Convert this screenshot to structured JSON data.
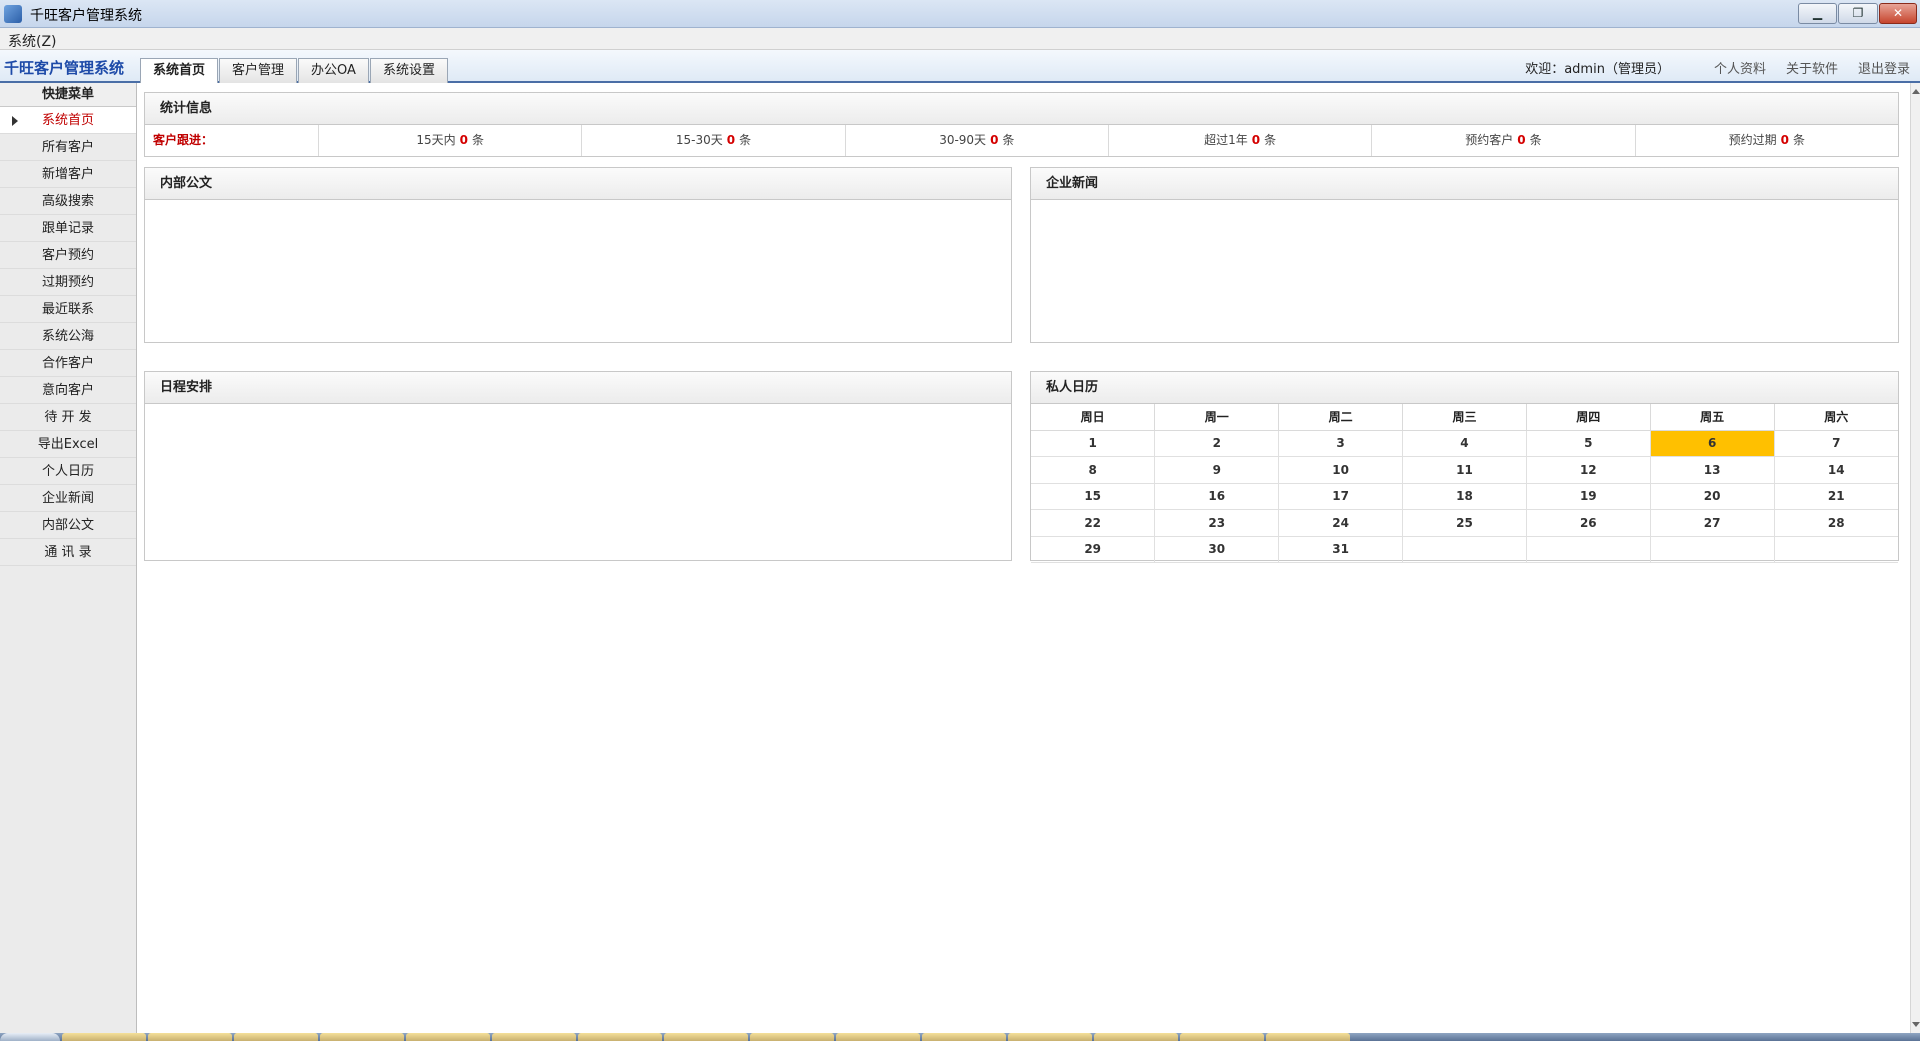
{
  "window": {
    "title": "千旺客户管理系统"
  },
  "menubar": {
    "items": [
      "系统(Z)"
    ]
  },
  "header": {
    "brand": "千旺客户管理系统",
    "tabs": [
      "系统首页",
      "客户管理",
      "办公OA",
      "系统设置"
    ],
    "active_tab": 0,
    "welcome": "欢迎：admin（管理员）",
    "links": [
      "个人资料",
      "关于软件",
      "退出登录"
    ]
  },
  "sidebar": {
    "title": "快捷菜单",
    "items": [
      "系统首页",
      "所有客户",
      "新增客户",
      "高级搜索",
      "跟单记录",
      "客户预约",
      "过期预约",
      "最近联系",
      "系统公海",
      "合作客户",
      "意向客户",
      "待 开 发",
      "导出Excel",
      "个人日历",
      "企业新闻",
      "内部公文",
      "通 讯 录"
    ],
    "active_index": 0
  },
  "stats": {
    "title": "统计信息",
    "row_label": "客户跟进：",
    "unit": "条",
    "cells": [
      {
        "label": "15天内",
        "value": "0"
      },
      {
        "label": "15-30天",
        "value": "0"
      },
      {
        "label": "30-90天",
        "value": "0"
      },
      {
        "label": "超过1年",
        "value": "0"
      },
      {
        "label": "预约客户",
        "value": "0"
      },
      {
        "label": "预约过期",
        "value": "0"
      }
    ]
  },
  "panels": {
    "internal_docs": "内部公文",
    "company_news": "企业新闻",
    "schedule": "日程安排",
    "calendar": "私人日历"
  },
  "calendar": {
    "weekdays": [
      "周日",
      "周一",
      "周二",
      "周三",
      "周四",
      "周五",
      "周六"
    ],
    "weeks": [
      [
        "1",
        "2",
        "3",
        "4",
        "5",
        "6",
        "7"
      ],
      [
        "8",
        "9",
        "10",
        "11",
        "12",
        "13",
        "14"
      ],
      [
        "15",
        "16",
        "17",
        "18",
        "19",
        "20",
        "21"
      ],
      [
        "22",
        "23",
        "24",
        "25",
        "26",
        "27",
        "28"
      ],
      [
        "29",
        "30",
        "31",
        "",
        "",
        "",
        ""
      ]
    ],
    "today": "6",
    "highlight_color": "#ffc000"
  },
  "colors": {
    "accent": "#1d4aa8",
    "active_red": "#c00000",
    "count_red": "#d40000"
  }
}
